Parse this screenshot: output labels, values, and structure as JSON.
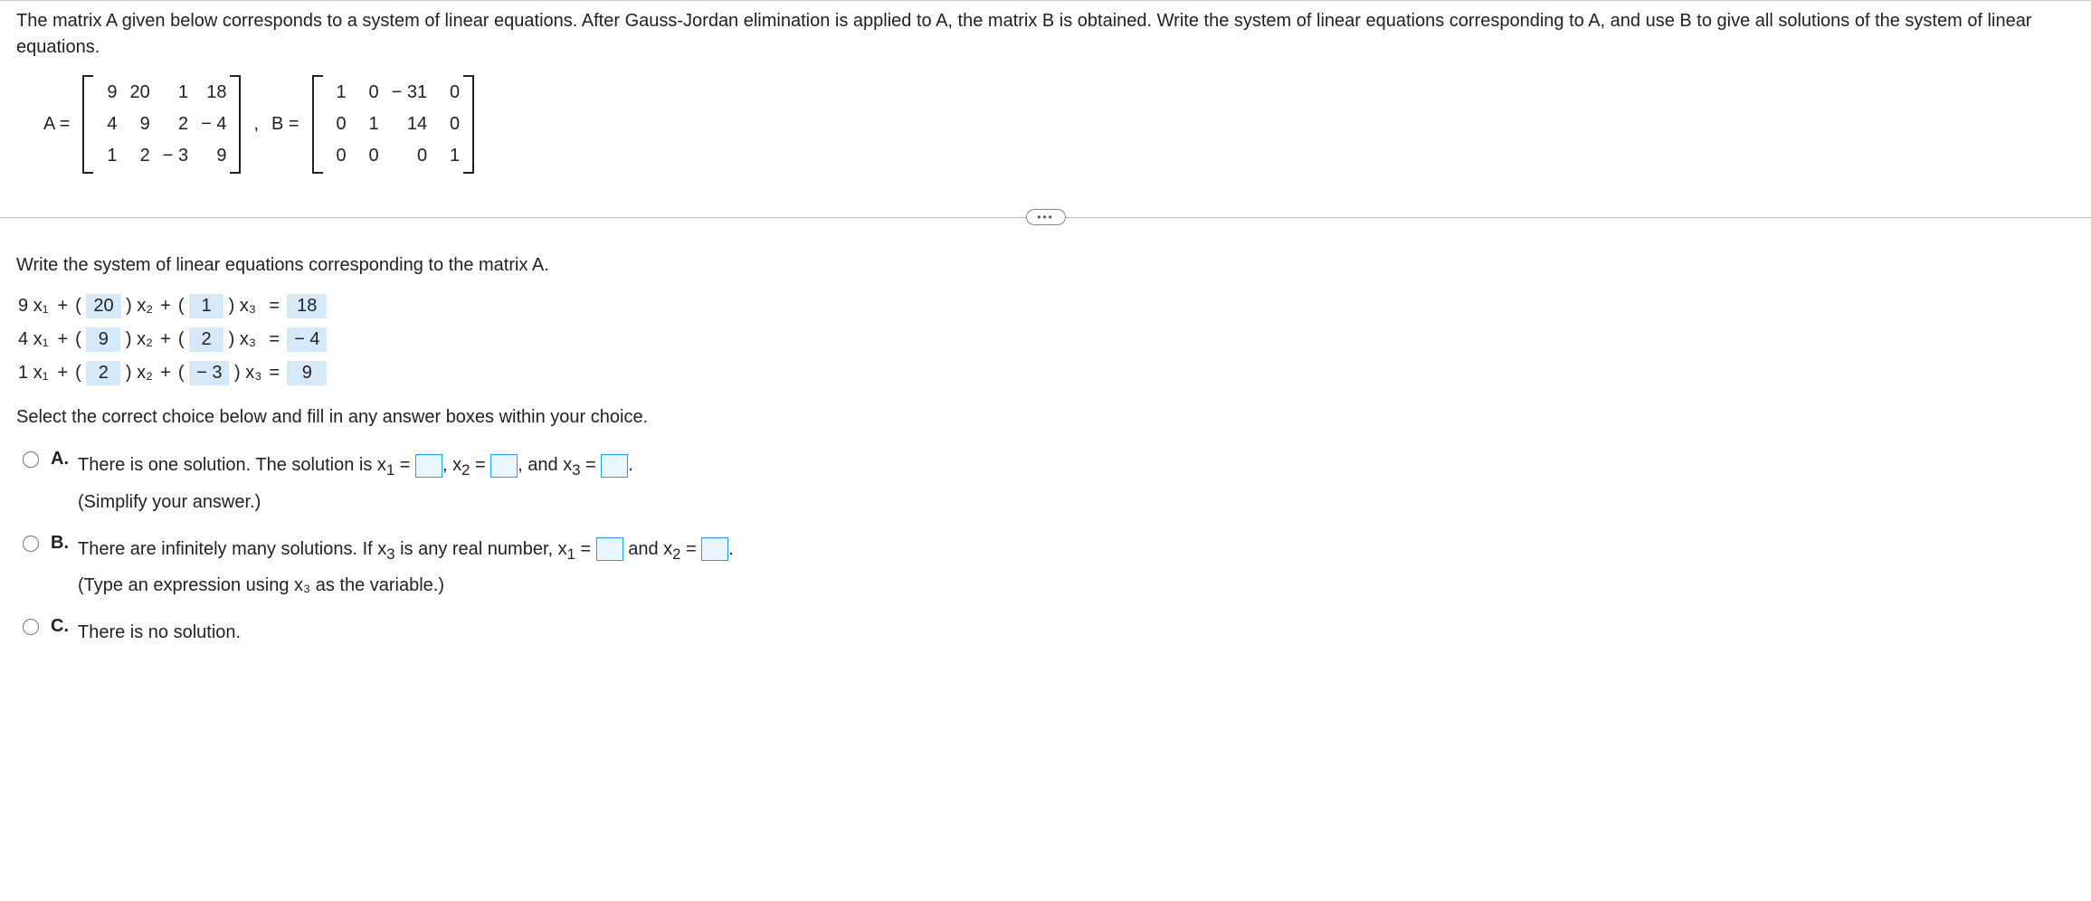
{
  "prompt": "The matrix A given below corresponds to a system of linear equations. After Gauss-Jordan elimination is applied to A, the matrix B is obtained. Write the system of linear equations corresponding to A, and use B to give all solutions of the system of linear equations.",
  "matA_label": "A =",
  "matB_label": "B =",
  "comma": ",",
  "A": {
    "r1": [
      "9",
      "20",
      "1",
      "18"
    ],
    "r2": [
      "4",
      "9",
      "2",
      "− 4"
    ],
    "r3": [
      "1",
      "2",
      "− 3",
      "9"
    ]
  },
  "B": {
    "r1": [
      "1",
      "0",
      "− 31",
      "0"
    ],
    "r2": [
      "0",
      "1",
      "14",
      "0"
    ],
    "r3": [
      "0",
      "0",
      "0",
      "1"
    ]
  },
  "ellipsis": "•••",
  "subprompt": "Write the system of linear equations corresponding to the matrix A.",
  "eqs": {
    "r1": {
      "c1": "9",
      "v2": "20",
      "v3": "1",
      "rhs": "18"
    },
    "r2": {
      "c1": "4",
      "v2": "9",
      "v3": "2",
      "rhs": "− 4"
    },
    "r3": {
      "c1": "1",
      "v2": "2",
      "v3": "− 3",
      "rhs": "9"
    }
  },
  "x1": "x₁",
  "x2": "x₂",
  "x3": "x₃",
  "plus": " + ",
  "open": "(",
  "close": ")",
  "equals": " = ",
  "choice_prompt": "Select the correct choice below and fill in any answer boxes within your choice.",
  "choiceA": {
    "label": "A.",
    "line1a": "There is one solution. The solution is x",
    "sub1": "1",
    "eqtxt": " = ",
    "comma_sp": ", x",
    "sub2": "2",
    "and_sp": ", and x",
    "sub3": "3",
    "period": ".",
    "hint": "(Simplify your answer.)"
  },
  "choiceB": {
    "label": "B.",
    "line1a": "There are infinitely many solutions. If x",
    "sub3": "3",
    "mid": " is any real number, x",
    "sub1": "1",
    "eqtxt": " = ",
    "and": " and x",
    "sub2": "2",
    "period": ".",
    "hint": "(Type an expression using x₃ as the variable.)"
  },
  "choiceC": {
    "label": "C.",
    "text": "There is no solution."
  }
}
